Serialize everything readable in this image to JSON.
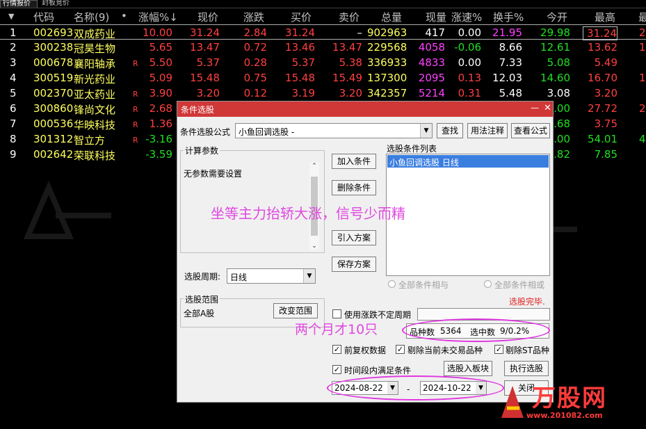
{
  "tabs": [
    "行情报价",
    "封板竞价"
  ],
  "header": {
    "sort_icon": "▼",
    "columns": [
      "代码",
      "名称(9)",
      "•",
      "涨幅%↓",
      "现价",
      "涨跌",
      "买价",
      "卖价",
      "总量",
      "现量",
      "涨速%",
      "换手%",
      "今开",
      "最高",
      "最"
    ]
  },
  "rows": [
    {
      "no": "1",
      "code": "002693",
      "name": "双成药业",
      "flag": "",
      "pct": "10.00",
      "price": "31.24",
      "chg": "2.84",
      "bid": "31.24",
      "ask": "–",
      "vol": "902963",
      "cur": "417",
      "spd": "0.00",
      "turn": "21.95",
      "open": "29.98",
      "high": "31.24",
      "last": "2"
    },
    {
      "no": "2",
      "code": "300238",
      "name": "冠昊生物",
      "flag": "",
      "pct": "5.65",
      "price": "13.47",
      "chg": "0.72",
      "bid": "13.46",
      "ask": "13.47",
      "vol": "229568",
      "cur": "4058",
      "spd": "-0.06",
      "turn": "8.66",
      "open": "12.61",
      "high": "13.62",
      "last": "1"
    },
    {
      "no": "3",
      "code": "000678",
      "name": "襄阳轴承",
      "flag": "R",
      "pct": "5.50",
      "price": "5.37",
      "chg": "0.28",
      "bid": "5.37",
      "ask": "5.38",
      "vol": "336933",
      "cur": "4833",
      "spd": "0.00",
      "turn": "7.33",
      "open": "5.08",
      "high": "5.49",
      "last": ""
    },
    {
      "no": "4",
      "code": "300519",
      "name": "新光药业",
      "flag": "",
      "pct": "5.09",
      "price": "15.48",
      "chg": "0.75",
      "bid": "15.48",
      "ask": "15.49",
      "vol": "137300",
      "cur": "2095",
      "spd": "0.13",
      "turn": "12.03",
      "open": "14.60",
      "high": "16.70",
      "last": "1"
    },
    {
      "no": "5",
      "code": "002370",
      "name": "亚太药业",
      "flag": "R",
      "pct": "3.90",
      "price": "3.20",
      "chg": "0.12",
      "bid": "3.19",
      "ask": "3.20",
      "vol": "342357",
      "cur": "5214",
      "spd": "0.31",
      "turn": "5.48",
      "open": "3.08",
      "high": "3.20",
      "last": ""
    },
    {
      "no": "6",
      "code": "300860",
      "name": "锋尚文化",
      "flag": "R",
      "pct": "2.68",
      "price": "",
      "chg": "",
      "bid": "",
      "ask": "",
      "vol": "",
      "cur": "",
      "spd": "",
      "turn": "",
      "open": ".00",
      "high": "27.72",
      "last": "2"
    },
    {
      "no": "7",
      "code": "000536",
      "name": "华映科技",
      "flag": "R",
      "pct": "1.36",
      "price": "",
      "chg": "",
      "bid": "",
      "ask": "",
      "vol": "",
      "cur": "",
      "spd": "",
      "turn": "",
      "open": ".68",
      "high": "3.75",
      "last": ""
    },
    {
      "no": "8",
      "code": "301312",
      "name": "智立方",
      "flag": "R",
      "pct": "-3.16",
      "price": "",
      "chg": "",
      "bid": "",
      "ask": "",
      "vol": "",
      "cur": "",
      "spd": "",
      "turn": "",
      "open": ".00",
      "high": "54.01",
      "last": "4"
    },
    {
      "no": "9",
      "code": "002642",
      "name": "荣联科技",
      "flag": "",
      "pct": "-3.59",
      "price": "",
      "chg": "",
      "bid": "",
      "ask": "",
      "vol": "",
      "cur": "",
      "spd": "",
      "turn": "",
      "open": ".82",
      "high": "7.85",
      "last": ""
    }
  ],
  "dialog": {
    "title": "条件选股",
    "min_icon": "—",
    "close_icon": "✕",
    "formula_label": "条件选股公式",
    "formula_value": "小鱼回调选股  -",
    "btn_find": "查找",
    "btn_usage": "用法注释",
    "btn_view": "查看公式",
    "params_title": "计算参数",
    "params_text": "无参数需要设置",
    "btn_add": "加入条件",
    "btn_del": "删除条件",
    "btn_import": "引入方案",
    "btn_save": "保存方案",
    "list_title": "选股条件列表",
    "list_item": "小鱼回调选股  日线",
    "period_label": "选股周期:",
    "period_value": "日线",
    "radio_and": "全部条件相与",
    "radio_or": "全部条件相或",
    "status": "选股完毕.",
    "range_title": "选股范围",
    "range_value": "全部A股",
    "btn_range": "改变范围",
    "use_uncertain": "使用涨跌不定周期",
    "count_label": "品种数",
    "count_value": "5364",
    "selected_label": "选中数",
    "selected_value": "9/0.2%",
    "cb_adjust": "前复权数据",
    "cb_exclude_untraded": "剔除当前未交易品种",
    "cb_exclude_st": "剔除ST品种",
    "cb_period": "时间段内满足条件",
    "btn_to_block": "选股入板块",
    "btn_run": "执行选股",
    "date_from": "2024-08-22",
    "date_sep": "-",
    "date_to": "2024-10-22",
    "btn_close": "关闭"
  },
  "annotations": {
    "main": "坐等主力抬轿大涨，信号少而精",
    "sub": "两个月才10只"
  },
  "watermark": {
    "brand": "万股网",
    "url": "www.201082.com"
  },
  "colors": {
    "red": "#ff4040",
    "green": "#20e020",
    "yellow": "#ffff60",
    "magenta": "#ff40ff",
    "white": "#ffffff",
    "title_red": "#d03737"
  }
}
